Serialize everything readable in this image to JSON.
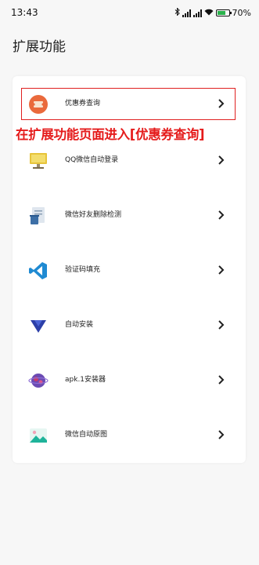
{
  "status_bar": {
    "time": "13:43",
    "battery_percent": "70%",
    "battery_level": 0.7,
    "battery_color": "#2bb24c"
  },
  "page": {
    "title": "扩展功能"
  },
  "menu": {
    "items": [
      {
        "label": "优惠券查询",
        "icon": "coupon-icon"
      },
      {
        "label": "QQ微信自动登录",
        "icon": "monitor-icon"
      },
      {
        "label": "微信好友删除检测",
        "icon": "trash-doc-icon"
      },
      {
        "label": "验证码填充",
        "icon": "vscode-icon"
      },
      {
        "label": "自动安装",
        "icon": "download-triangle-icon"
      },
      {
        "label": "apk.1安装器",
        "icon": "planet-icon"
      },
      {
        "label": "微信自动原图",
        "icon": "image-icon"
      }
    ]
  },
  "annotation": {
    "text": "在扩展功能页面进入[优惠券查询]",
    "color": "#e51c1c"
  }
}
